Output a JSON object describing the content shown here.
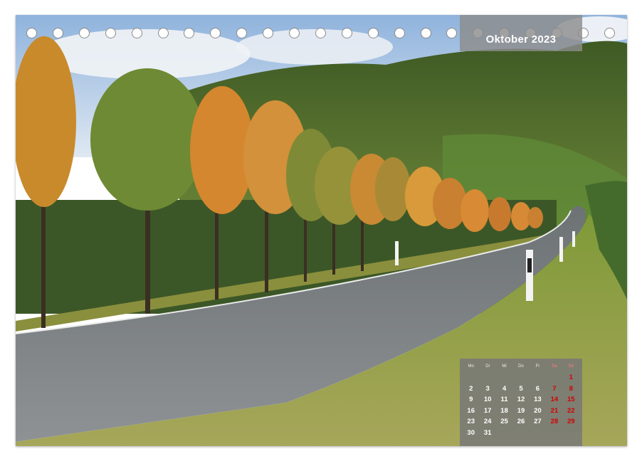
{
  "calendar": {
    "month_label": "Oktober 2023",
    "weekdays": [
      "Mo",
      "Di",
      "Mi",
      "Do",
      "Fr",
      "Sa",
      "So"
    ],
    "weeks": [
      [
        "",
        "",
        "",
        "",
        "",
        "",
        "1"
      ],
      [
        "2",
        "3",
        "4",
        "5",
        "6",
        "7",
        "8"
      ],
      [
        "9",
        "10",
        "11",
        "12",
        "13",
        "14",
        "15"
      ],
      [
        "16",
        "17",
        "18",
        "19",
        "20",
        "21",
        "22"
      ],
      [
        "23",
        "24",
        "25",
        "26",
        "27",
        "28",
        "29"
      ],
      [
        "30",
        "31",
        "",
        "",
        "",
        "",
        ""
      ]
    ]
  },
  "colors": {
    "weekend": "#d40000",
    "label_bg": "#8c8c8c",
    "ring": "#8a8a8a"
  },
  "photo": {
    "subject": "tree-lined-road-in-autumn-landscape"
  }
}
